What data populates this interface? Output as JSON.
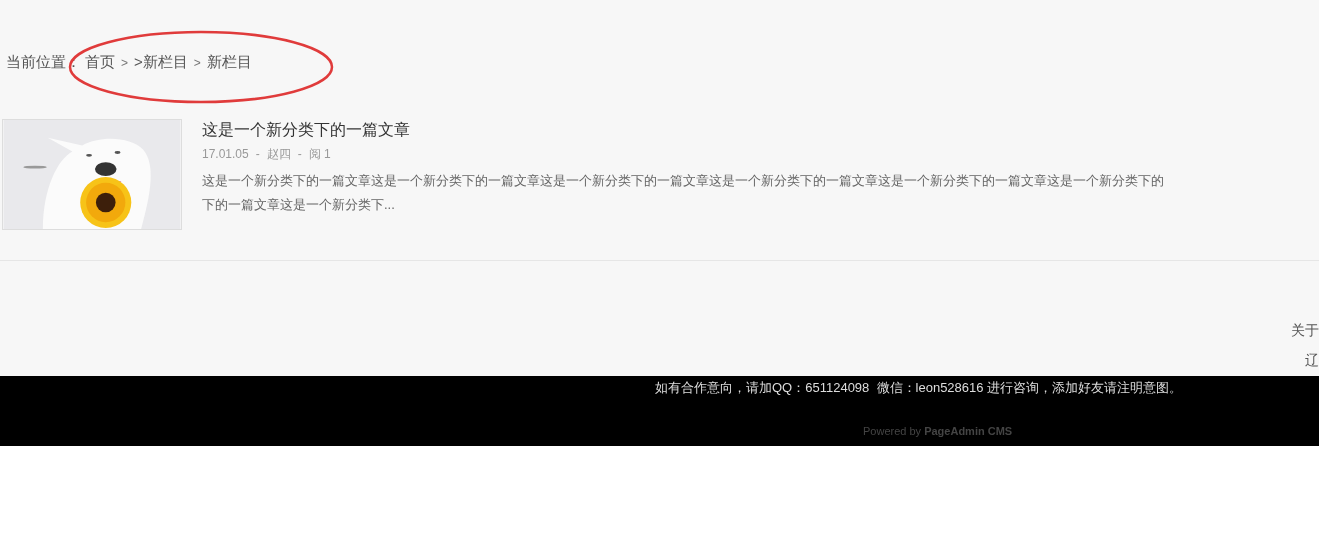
{
  "breadcrumb": {
    "label": "当前位置：",
    "parts": [
      {
        "kind": "link",
        "text": "首页"
      },
      {
        "kind": "separator",
        "text": ">"
      },
      {
        "kind": "link",
        "text": ">新栏目"
      },
      {
        "kind": "separator",
        "text": ">"
      },
      {
        "kind": "link",
        "text": "新栏目"
      }
    ]
  },
  "articles": [
    {
      "title": "这是一个新分类下的一篇文章",
      "meta": [
        {
          "kind": "date",
          "text": "17.01.05"
        },
        {
          "kind": "separator",
          "text": "-"
        },
        {
          "kind": "author",
          "text": "赵四"
        },
        {
          "kind": "separator",
          "text": "-"
        },
        {
          "kind": "views",
          "text": "阅 1"
        }
      ],
      "summary_lines": [
        "这是一个新分类下的一篇文章这是一个新分类下的一篇文章这是一个新分类下的一篇文章这是一个新分类下的一篇文章这是一个新分类下的一篇文章这是一个新分类下的",
        "下的一篇文章这是一个新分类下..."
      ]
    }
  ],
  "footer_links": [
    "关于",
    "辽"
  ],
  "footer": {
    "contact": "如有合作意向，请加QQ：651124098  微信：leon528616 进行咨询，添加好友请注明意图。",
    "powered_prefix": "Powered by",
    "powered_brand": "PageAdmin CMS"
  }
}
